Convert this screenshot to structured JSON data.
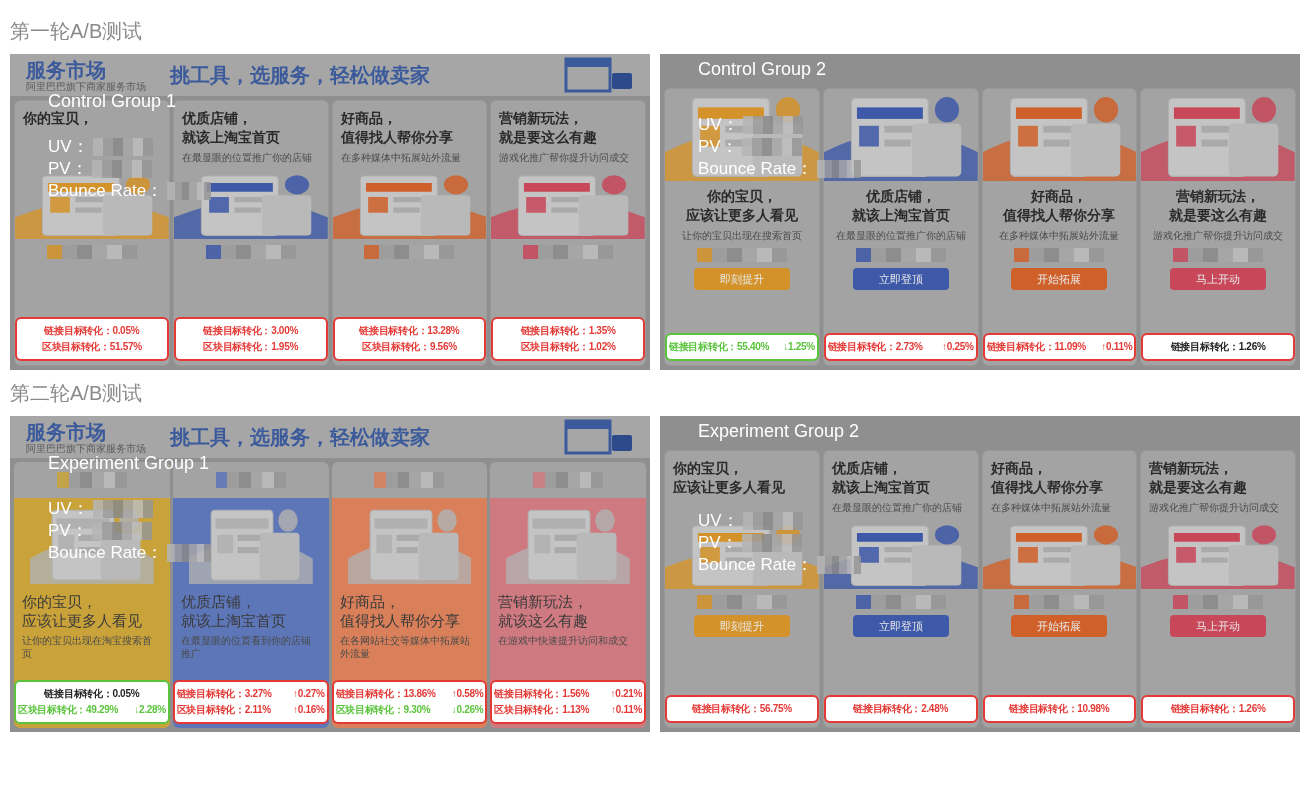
{
  "rounds": [
    {
      "title": "第一轮A/B测试",
      "panels": [
        {
          "kind": "classic",
          "banner": {
            "logo": "服务市场",
            "logo_sub": "阿里巴巴旗下商家服务市场",
            "slogan": "挑工具，选服务，轻松做卖家"
          },
          "group_label": "Control Group 1",
          "metrics": [
            "UV：",
            "PV：",
            "Bounce Rate："
          ],
          "cards": [
            {
              "color": "#d4932a",
              "headline": [
                "你的**宝贝**，"
              ],
              "stats": {
                "color": "#e53935",
                "lines": [
                  {
                    "text": "链接目标转化：0.05%",
                    "color": "#e53935"
                  },
                  {
                    "text": "区块目标转化：51.57%",
                    "color": "#e53935"
                  }
                ]
              }
            },
            {
              "color": "#3d59a8",
              "headline": [
                "优质**店铺**，",
                "就该上淘宝首页"
              ],
              "subline": "在最显眼的位置推广你的店铺",
              "stats": {
                "color": "#e53935",
                "lines": [
                  {
                    "text": "链接目标转化：3.00%",
                    "color": "#e53935"
                  },
                  {
                    "text": "区块目标转化：1.95%",
                    "color": "#e53935"
                  }
                ]
              }
            },
            {
              "color": "#d0602a",
              "headline": [
                "好商品，",
                "值得找人帮你**分享**"
              ],
              "subline": "在多种媒体中拓展站外流量",
              "stats": {
                "color": "#e53935",
                "lines": [
                  {
                    "text": "链接目标转化：13.28%",
                    "color": "#e53935"
                  },
                  {
                    "text": "区块目标转化：9.56%",
                    "color": "#e53935"
                  }
                ]
              }
            },
            {
              "color": "#c8485a",
              "headline": [
                "营销**新玩法**，",
                "就是要这么有趣"
              ],
              "subline": "游戏化推广帮你提升访问成交",
              "stats": {
                "color": "#e53935",
                "lines": [
                  {
                    "text": "链接目标转化：1.35%",
                    "color": "#e53935"
                  },
                  {
                    "text": "区块目标转化：1.02%",
                    "color": "#e53935"
                  }
                ]
              }
            }
          ]
        },
        {
          "kind": "centered",
          "group_label": "Control Group 2",
          "metrics": [
            "UV：",
            "PV：",
            "Bounce Rate："
          ],
          "cards": [
            {
              "color": "#d4932a",
              "headline": [
                "你的**宝贝**，",
                "应该让更多人看见"
              ],
              "subline": "让你的宝贝出现在搜索首页",
              "button": "即刻提升",
              "stats": {
                "color": "#5ac43c",
                "lines": [
                  {
                    "text": "链接目标转化：55.40%",
                    "change": "↓1.25%",
                    "color": "#5ac43c"
                  }
                ]
              }
            },
            {
              "color": "#3d59a8",
              "headline": [
                "优质**店铺**，",
                "就该上淘宝首页"
              ],
              "subline": "在最显眼的位置推广你的店铺",
              "button": "立即登顶",
              "stats": {
                "color": "#e53935",
                "lines": [
                  {
                    "text": "链接目标转化：2.73%",
                    "change": "↑0.25%",
                    "color": "#e53935"
                  }
                ]
              }
            },
            {
              "color": "#d0602a",
              "headline": [
                "好商品，",
                "值得找人帮你**分享**"
              ],
              "subline": "在多种媒体中拓展站外流量",
              "button": "开始拓展",
              "stats": {
                "color": "#e53935",
                "lines": [
                  {
                    "text": "链接目标转化：11.09%",
                    "change": "↑0.11%",
                    "color": "#e53935"
                  }
                ]
              }
            },
            {
              "color": "#c8485a",
              "headline": [
                "营销**新玩法**，",
                "就是要这么有趣"
              ],
              "subline": "游戏化推广帮你提升访问成交",
              "button": "马上开动",
              "stats": {
                "color": "#e53935",
                "lines": [
                  {
                    "text": "链接目标转化：1.26%",
                    "color": "#222222"
                  }
                ]
              }
            }
          ]
        }
      ]
    },
    {
      "title": "第二轮A/B测试",
      "panels": [
        {
          "kind": "tinted",
          "banner": {
            "logo": "服务市场",
            "logo_sub": "阿里巴巴旗下商家服务市场",
            "slogan": "挑工具，选服务，轻松做卖家"
          },
          "group_label": "Experiment Group 1",
          "metrics": [
            "UV：",
            "PV：",
            "Bounce Rate："
          ],
          "cards": [
            {
              "color": "#c9a33a",
              "headline": [
                "你的宝贝，",
                "应该让更多人看见"
              ],
              "subline": "让你的宝贝出现在淘宝搜索首页",
              "stats": {
                "color": "#5ac43c",
                "lines": [
                  {
                    "text": "链接目标转化：0.05%",
                    "color": "#222222"
                  },
                  {
                    "text": "区块目标转化：49.29%",
                    "change": "↓2.28%",
                    "color": "#5ac43c"
                  }
                ]
              }
            },
            {
              "color": "#5d76b8",
              "headline": [
                "优质店铺，",
                "就该上淘宝首页"
              ],
              "subline": "在最显眼的位置看到你的店铺推广",
              "stats": {
                "color": "#e53935",
                "lines": [
                  {
                    "text": "链接目标转化：3.27%",
                    "change": "↑0.27%",
                    "color": "#e53935"
                  },
                  {
                    "text": "区块目标转化：2.11%",
                    "change": "↑0.16%",
                    "color": "#e53935"
                  }
                ]
              }
            },
            {
              "color": "#d9805a",
              "headline": [
                "好商品，",
                "值得找人帮你分享"
              ],
              "subline": "在各网站社交等媒体中拓展站外流量",
              "stats": {
                "color": "#e53935",
                "lines": [
                  {
                    "text": "链接目标转化：13.86%",
                    "change": "↑0.58%",
                    "color": "#e53935"
                  },
                  {
                    "text": "区块目标转化：9.30%",
                    "change": "↓0.26%",
                    "color": "#5ac43c"
                  }
                ]
              }
            },
            {
              "color": "#cf7a80",
              "headline": [
                "营销新玩法，",
                "就该这么有趣"
              ],
              "subline": "在游戏中快速提升访问和成交",
              "stats": {
                "color": "#e53935",
                "lines": [
                  {
                    "text": "链接目标转化：1.56%",
                    "change": "↑0.21%",
                    "color": "#e53935"
                  },
                  {
                    "text": "区块目标转化：1.13%",
                    "change": "↑0.11%",
                    "color": "#e53935"
                  }
                ]
              }
            }
          ]
        },
        {
          "kind": "classic",
          "group_label": "Experiment Group 2",
          "metrics": [
            "UV：",
            "PV：",
            "Bounce Rate："
          ],
          "cards": [
            {
              "color": "#d4932a",
              "headline": [
                "你的**宝贝**，",
                "应该让更多人看见"
              ],
              "button": "即刻提升",
              "stats": {
                "color": "#e53935",
                "lines": [
                  {
                    "text": "链接目标转化：56.75%",
                    "color": "#e53935"
                  }
                ]
              }
            },
            {
              "color": "#3d59a8",
              "headline": [
                "优质**店铺**，",
                "就该上淘宝首页"
              ],
              "subline": "在最显眼的位置推广你的店铺",
              "button": "立即登顶",
              "stats": {
                "color": "#e53935",
                "lines": [
                  {
                    "text": "链接目标转化：2.48%",
                    "color": "#e53935"
                  }
                ]
              }
            },
            {
              "color": "#d0602a",
              "headline": [
                "好商品，",
                "值得找人帮你**分享**"
              ],
              "subline": "在多种媒体中拓展站外流量",
              "button": "开始拓展",
              "stats": {
                "color": "#e53935",
                "lines": [
                  {
                    "text": "链接目标转化：10.98%",
                    "color": "#e53935"
                  }
                ]
              }
            },
            {
              "color": "#c8485a",
              "headline": [
                "营销**新玩法**，",
                "就是要这么有趣"
              ],
              "subline": "游戏化推广帮你提升访问成交",
              "button": "马上开动",
              "stats": {
                "color": "#e53935",
                "lines": [
                  {
                    "text": "链接目标转化：1.26%",
                    "color": "#e53935"
                  }
                ]
              }
            }
          ]
        }
      ]
    }
  ]
}
